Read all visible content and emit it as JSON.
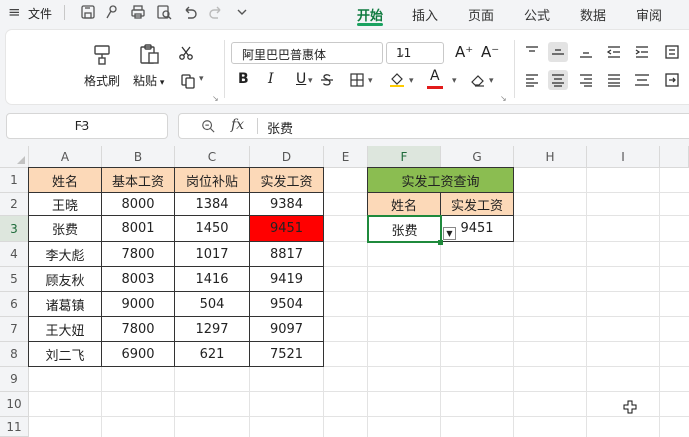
{
  "menubar": {
    "file_label": "文件",
    "tabs": [
      {
        "label": "开始",
        "active": true
      },
      {
        "label": "插入",
        "active": false
      },
      {
        "label": "页面",
        "active": false
      },
      {
        "label": "公式",
        "active": false
      },
      {
        "label": "数据",
        "active": false
      },
      {
        "label": "审阅",
        "active": false
      }
    ],
    "quick_access": [
      "save-icon",
      "brush-icon",
      "print-icon",
      "undo-icon",
      "redo-icon",
      "chevron-down-icon"
    ]
  },
  "ribbon": {
    "format_painter_label": "格式刷",
    "paste_label": "粘贴",
    "font_name": "阿里巴巴普惠体",
    "font_size": "11",
    "bold": "B",
    "italic": "I",
    "underline": "U",
    "grow_font": "A⁺",
    "shrink_font": "A⁻",
    "font_color_glyph": "A",
    "colors": {
      "font_color": "#e21b1b",
      "fill_color": "#ffcc00",
      "accent": "#1aa260"
    }
  },
  "formula_bar": {
    "name_box": "F3",
    "fx_label": "fx",
    "value": "张费"
  },
  "grid": {
    "columns": [
      "A",
      "B",
      "C",
      "D",
      "E",
      "F",
      "G",
      "H",
      "I"
    ],
    "rows": [
      "1",
      "2",
      "3",
      "4",
      "5",
      "6",
      "7",
      "8",
      "9",
      "10",
      "11"
    ],
    "selected_column": "F",
    "selected_row": "3",
    "table_headers": [
      "姓名",
      "基本工资",
      "岗位补贴",
      "实发工资"
    ],
    "table_rows": [
      [
        "王晓",
        "8000",
        "1384",
        "9384"
      ],
      [
        "张费",
        "8001",
        "1450",
        "9451"
      ],
      [
        "李大彪",
        "7800",
        "1017",
        "8817"
      ],
      [
        "顾友秋",
        "8003",
        "1416",
        "9419"
      ],
      [
        "诸葛镇",
        "9000",
        "504",
        "9504"
      ],
      [
        "王大妞",
        "7800",
        "1297",
        "9097"
      ],
      [
        "刘二飞",
        "6900",
        "621",
        "7521"
      ]
    ],
    "lookup": {
      "title": "实发工资查询",
      "headers": [
        "姓名",
        "实发工资"
      ],
      "name_value": "张费",
      "salary_value": "9451"
    },
    "colors": {
      "header_fill": "#fcd9b8",
      "title_fill": "#8bbd51",
      "highlight_fill": "#ff0000",
      "selection": "#1f8a3c"
    }
  }
}
